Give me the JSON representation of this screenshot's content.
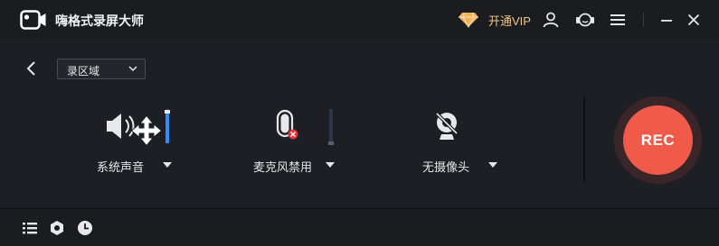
{
  "app": {
    "title": "嗨格式录屏大师"
  },
  "titlebar": {
    "vip_label": "开通VIP",
    "icons": [
      "diamond-icon",
      "user-icon",
      "support-icon",
      "menu-icon",
      "minimize-icon",
      "close-icon"
    ]
  },
  "toolbar": {
    "mode_selected": "录区域"
  },
  "devices": {
    "speaker": {
      "label": "系统声音",
      "level": 0.92
    },
    "mic": {
      "label": "麦克风禁用",
      "level": 0.0
    },
    "camera": {
      "label": "无摄像头"
    }
  },
  "record": {
    "label": "REC"
  },
  "bottom": {
    "icons": [
      "list-icon",
      "settings-icon",
      "clock-icon"
    ]
  },
  "colors": {
    "accent_blue": "#2f8cff",
    "record_red": "#f05a48",
    "vip_gold": "#f2c48a",
    "background": "#1e1f24"
  }
}
